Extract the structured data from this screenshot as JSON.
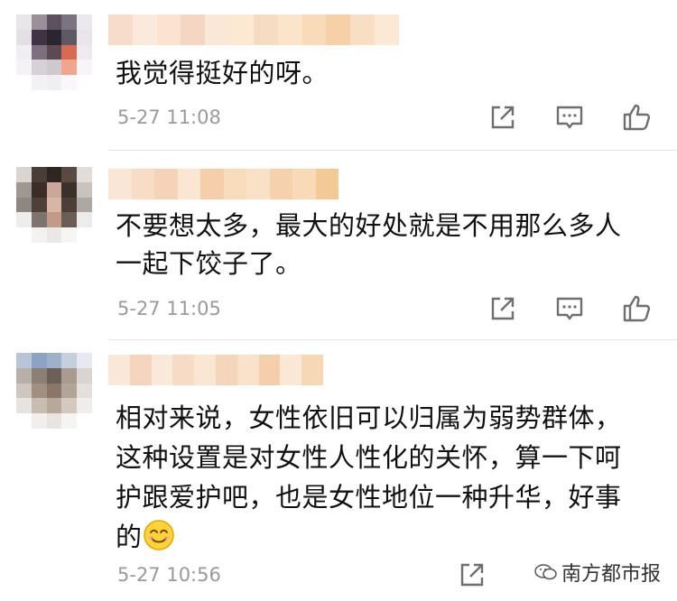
{
  "comments": [
    {
      "text_lines": [
        "我觉得挺好的呀。"
      ],
      "time": "5-27 11:08",
      "avatar_colors": [
        "#e9e6e8",
        "#9b8f98",
        "#5d5160",
        "#7b7380",
        "#ece9ee",
        "#e3dfe4",
        "#3e3444",
        "#2b2530",
        "#5f5865",
        "#e9e5ea",
        "#f1eef2",
        "#7c707c",
        "#5b4a56",
        "#d86a54",
        "#eeeaee",
        "#f4f2f4",
        "#d6d1d6",
        "#cfc8cf",
        "#f0a58e",
        "#f7f5f7",
        "#ffffff",
        "#f3f1f3",
        "#f1eef1",
        "#f9f7f9",
        "#ffffff"
      ],
      "name_colors": [
        "#f6dcc9",
        "#fbe9dc",
        "#fae3d0",
        "#f5d6c2",
        "#f9e7d8",
        "#fde8d2",
        "#f7dcc4",
        "#fbe4c9",
        "#f9dbb9",
        "#f6d0a7",
        "#f8dfc4",
        "#fbe9d6"
      ]
    },
    {
      "text_lines": [
        "不要想太多，最大的好处就是不用那么多人",
        "一起下饺子了。"
      ],
      "time": "5-27 11:05",
      "avatar_colors": [
        "#d9d5d1",
        "#4a3c36",
        "#2f2521",
        "#5a4a42",
        "#e2ddd8",
        "#9d9894",
        "#3a2d27",
        "#caa79a",
        "#3c302a",
        "#c8c3bf",
        "#8c8782",
        "#4e3f37",
        "#d8b6a5",
        "#4d3f37",
        "#ada8a3",
        "#efedeb",
        "#7d746f",
        "#c29a88",
        "#6a5d55",
        "#eeecea",
        "#ffffff",
        "#f3f2f1",
        "#ebe7e4",
        "#f6f5f4",
        "#ffffff"
      ],
      "name_colors": [
        "#fae6d5",
        "#f8dcc6",
        "#f6d2b8",
        "#fbe6d2",
        "#f5cfa9",
        "#f8ddbd",
        "#f9e1c6",
        "#f5d1ac",
        "#f8dab7",
        "#f3c995"
      ]
    },
    {
      "text_lines": [
        "相对来说，女性依旧可以归属为弱势群体，",
        "这种设置是对女性人性化的关怀，算一下呵",
        "护跟爱护吧，也是女性地位一种升华，好事",
        "的"
      ],
      "time": "5-27 10:56",
      "avatar_colors": [
        "#b9c5d6",
        "#8ea3c4",
        "#9fb0cb",
        "#c6cfdc",
        "#e6eaf0",
        "#b6b0a8",
        "#8c7f74",
        "#6d6058",
        "#a99b90",
        "#d9d4cf",
        "#cfc7bf",
        "#a28f80",
        "#8a776a",
        "#b3a498",
        "#e4dfda",
        "#e7e3df",
        "#c9bdb2",
        "#b7a89b",
        "#d3c9bf",
        "#f0edea",
        "#ffffff",
        "#f1eeeb",
        "#e9e4df",
        "#f6f4f2",
        "#ffffff"
      ],
      "name_colors": [
        "#f9e7d7",
        "#f5d5bd",
        "#fae9da",
        "#f7dcc5",
        "#fbe6d2",
        "#f6d6bb",
        "#f9e2ca",
        "#f5cfac",
        "#fbe8d4",
        "#f7d8b4"
      ]
    }
  ],
  "watermark": "南方都市报",
  "icons": [
    "share-icon",
    "comment-icon",
    "like-icon",
    "smile-emoji-icon",
    "wechat-icon"
  ],
  "colors": {
    "time": "#9a9a9a",
    "icon": "#6f6f6f",
    "divider": "#e6e6e6"
  }
}
